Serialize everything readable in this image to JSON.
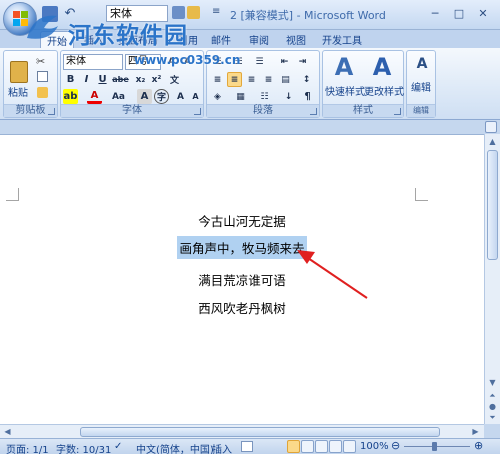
{
  "window": {
    "title": "2 [兼容模式] - Microsoft Word",
    "font_name": "宋体"
  },
  "watermark": {
    "text": "河东软件园",
    "url": "www.pc0359.cn"
  },
  "tabs": [
    "开始",
    "插入",
    "页面布局",
    "引用",
    "邮件",
    "审阅",
    "视图",
    "开发工具"
  ],
  "ribbon": {
    "font_name": "宋体",
    "font_size": "四号",
    "groups": {
      "clipboard": "剪贴板",
      "font": "字体",
      "paragraph": "段落",
      "styles": "样式",
      "editing": "编辑"
    },
    "paste_label": "粘贴",
    "quick_style_label": "快速样式",
    "change_style_label": "更改样式",
    "edit_label": "编辑"
  },
  "document": {
    "lines": [
      "今古山河无定据",
      "画角声中，牧马频来去",
      "满目荒凉谁可语",
      "西风吹老丹枫树"
    ],
    "highlighted_line_index": 1
  },
  "statusbar": {
    "page": "页面: 1/1",
    "words": "字数: 10/31",
    "language": "中文(简体，中国)",
    "insert_mode": "插入",
    "zoom": "100%"
  },
  "colors": {
    "accent": "#15428b",
    "highlight": "#b0d1f1",
    "arrow": "#e02020"
  }
}
